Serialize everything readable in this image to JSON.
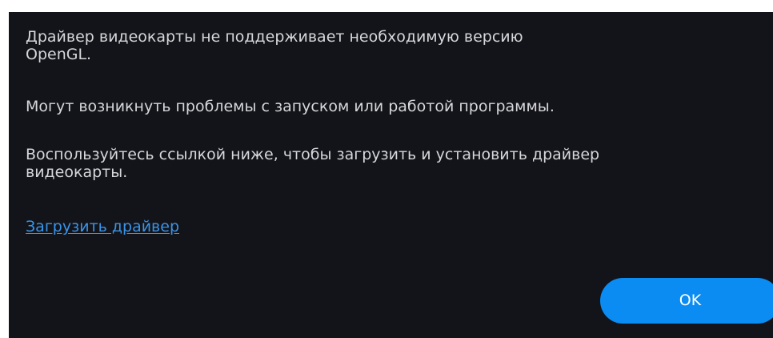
{
  "dialog": {
    "message_1": [
      "Драйвер видеокарты не поддерживает необходимую версию",
      "OpenGL."
    ],
    "message_2": "Могут возникнуть проблемы с запуском или работой программы.",
    "message_3": [
      "Воспользуйтесь ссылкой ниже, чтобы загрузить и установить драйвер",
      "видеокарты."
    ],
    "download_link_label": "Загрузить драйвер",
    "ok_button_label": "OK"
  },
  "colors": {
    "background": "#131419",
    "text": "#d6d7da",
    "link": "#3a93e8",
    "button": "#0a8cf2"
  }
}
